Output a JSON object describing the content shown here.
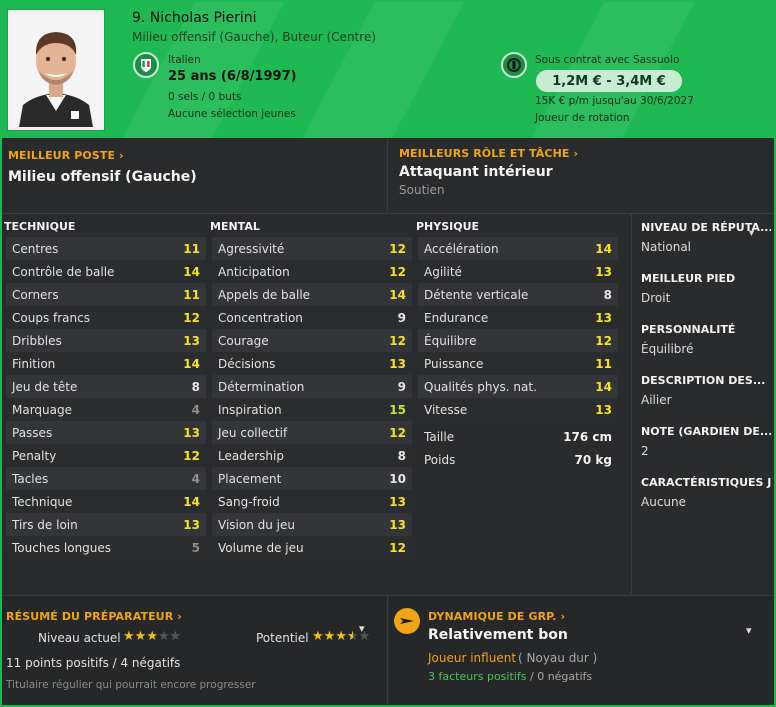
{
  "header": {
    "name": "9. Nicholas Pierini",
    "positions": "Milieu offensif (Gauche), Buteur (Centre)",
    "nationality": "Italien",
    "age": "25 ans (6/8/1997)",
    "caps": "0 sels / 0 buts",
    "youth": "Aucune sélection jeunes",
    "contract": "Sous contrat avec Sassuolo",
    "value": "1,2M € - 3,4M €",
    "wage": "15K € p/m jusqu'au 30/6/2027",
    "squad_status": "Joueur de rotation"
  },
  "best_position": {
    "title": "MEILLEUR POSTE ›",
    "value": "Milieu offensif (Gauche)"
  },
  "best_role": {
    "title": "MEILLEURS RÔLE ET TÂCHE ›",
    "value": "Attaquant intérieur",
    "duty": "Soutien"
  },
  "attributes": {
    "technical": {
      "header": "TECHNIQUE",
      "items": [
        {
          "label": "Centres",
          "value": "11"
        },
        {
          "label": "Contrôle de balle",
          "value": "14"
        },
        {
          "label": "Corners",
          "value": "11"
        },
        {
          "label": "Coups francs",
          "value": "12"
        },
        {
          "label": "Dribbles",
          "value": "13"
        },
        {
          "label": "Finition",
          "value": "14"
        },
        {
          "label": "Jeu de tête",
          "value": "8"
        },
        {
          "label": "Marquage",
          "value": "4"
        },
        {
          "label": "Passes",
          "value": "13"
        },
        {
          "label": "Penalty",
          "value": "12"
        },
        {
          "label": "Tacles",
          "value": "4"
        },
        {
          "label": "Technique",
          "value": "14"
        },
        {
          "label": "Tirs de loin",
          "value": "13"
        },
        {
          "label": "Touches longues",
          "value": "5"
        }
      ]
    },
    "mental": {
      "header": "MENTAL",
      "items": [
        {
          "label": "Agressivité",
          "value": "12"
        },
        {
          "label": "Anticipation",
          "value": "12"
        },
        {
          "label": "Appels de balle",
          "value": "14"
        },
        {
          "label": "Concentration",
          "value": "9"
        },
        {
          "label": "Courage",
          "value": "12"
        },
        {
          "label": "Décisions",
          "value": "13"
        },
        {
          "label": "Détermination",
          "value": "9"
        },
        {
          "label": "Inspiration",
          "value": "15"
        },
        {
          "label": "Jeu collectif",
          "value": "12"
        },
        {
          "label": "Leadership",
          "value": "8"
        },
        {
          "label": "Placement",
          "value": "10"
        },
        {
          "label": "Sang-froid",
          "value": "13"
        },
        {
          "label": "Vision du jeu",
          "value": "13"
        },
        {
          "label": "Volume de jeu",
          "value": "12"
        }
      ]
    },
    "physical": {
      "header": "PHYSIQUE",
      "items": [
        {
          "label": "Accélération",
          "value": "14"
        },
        {
          "label": "Agilité",
          "value": "13"
        },
        {
          "label": "Détente verticale",
          "value": "8"
        },
        {
          "label": "Endurance",
          "value": "13"
        },
        {
          "label": "Équilibre",
          "value": "12"
        },
        {
          "label": "Puissance",
          "value": "11"
        },
        {
          "label": "Qualités phys. nat.",
          "value": "14"
        },
        {
          "label": "Vitesse",
          "value": "13"
        }
      ],
      "height_label": "Taille",
      "height_value": "176 cm",
      "weight_label": "Poids",
      "weight_value": "70 kg"
    }
  },
  "sidebar": {
    "reputation_label": "NIVEAU DE RÉPUTA...",
    "reputation_value": "National",
    "foot_label": "MEILLEUR PIED",
    "foot_value": "Droit",
    "personality_label": "PERSONNALITÉ",
    "personality_value": "Équilibré",
    "description_label": "DESCRIPTION DES...",
    "description_value": "Ailier",
    "gk_label": "NOTE (GARDIEN DE...",
    "gk_value": "2",
    "traits_label": "CARACTÉRISTIQUES J",
    "traits_value": "Aucune"
  },
  "coach_report": {
    "title": "RÉSUMÉ DU PRÉPARATEUR ›",
    "current_label": "Niveau actuel",
    "potential_label": "Potentiel",
    "current_stars": 3,
    "potential_stars": 3.5,
    "points": "11 points positifs / 4 négatifs",
    "note": "Titulaire régulier qui pourrait encore progresser"
  },
  "dynamics": {
    "title": "DYNAMIQUE DE GRP. ›",
    "value": "Relativement bon",
    "influence": "Joueur influent",
    "influence_group": "( Noyau dur )",
    "positives": "3 facteurs positifs",
    "negatives": "/  0 négatifs"
  },
  "icons": {
    "nationality_flag": "italy-federation-icon",
    "club_badge": "sassuolo-badge-icon",
    "dynamics": "plane-icon",
    "chevron": "chevron-down-icon"
  },
  "colors": {
    "header_green": "#1fb954",
    "accent_orange": "#f0a416",
    "star_gold": "#f0c20f",
    "attr_high": "#f5e12a",
    "attr_low": "#8f8f8f"
  }
}
